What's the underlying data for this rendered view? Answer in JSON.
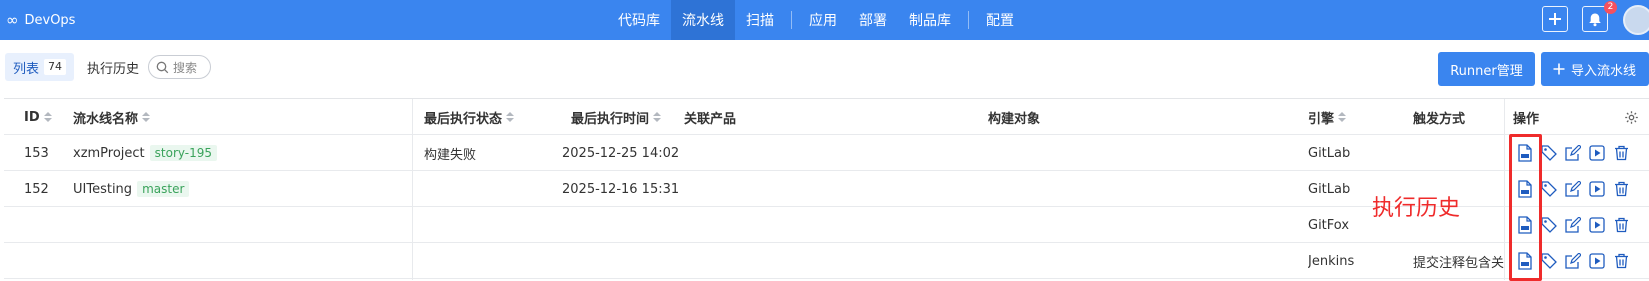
{
  "brand": {
    "name": "DevOps"
  },
  "nav": [
    {
      "label": "代码库",
      "active": false
    },
    {
      "label": "流水线",
      "active": true
    },
    {
      "label": "扫描",
      "active": false
    },
    {
      "label": "应用",
      "active": false
    },
    {
      "label": "部署",
      "active": false
    },
    {
      "label": "制品库",
      "active": false
    },
    {
      "label": "配置",
      "active": false
    }
  ],
  "notifications": {
    "count": "2"
  },
  "toolbar": {
    "tab_list_label": "列表",
    "tab_list_count": "74",
    "tab_history_label": "执行历史",
    "search_placeholder": "搜索",
    "runner_button": "Runner管理",
    "import_button": "导入流水线"
  },
  "table": {
    "headers": {
      "id": "ID",
      "name": "流水线名称",
      "status": "最后执行状态",
      "time": "最后执行时间",
      "product": "关联产品",
      "target": "构建对象",
      "engine": "引擎",
      "trigger": "触发方式",
      "ops": "操作"
    },
    "rows": [
      {
        "id": "153",
        "name": "xzmProject",
        "tag": "story-195",
        "status": "构建失败",
        "time": "2025-12-25 14:02",
        "product": "",
        "target": "",
        "engine": "GitLab",
        "trigger": ""
      },
      {
        "id": "152",
        "name": "UITesting",
        "tag": "master",
        "status": "",
        "time": "2025-12-16 15:31",
        "product": "",
        "target": "",
        "engine": "GitLab",
        "trigger": ""
      },
      {
        "id": "",
        "name": "",
        "tag": "",
        "status": "",
        "time": "",
        "product": "",
        "target": "",
        "engine": "GitFox",
        "trigger": ""
      },
      {
        "id": "",
        "name": "",
        "tag": "",
        "status": "",
        "time": "",
        "product": "",
        "target": "",
        "engine": "Jenkins",
        "trigger": "提交注释包含关"
      }
    ]
  },
  "annotation": {
    "text": "执行历史",
    "color": "#ef2b2b"
  },
  "colors": {
    "primary": "#3a85ef",
    "tag_bg": "#eaf7ef",
    "tag_text": "#3aa35b",
    "icon": "#1f5cbf"
  }
}
